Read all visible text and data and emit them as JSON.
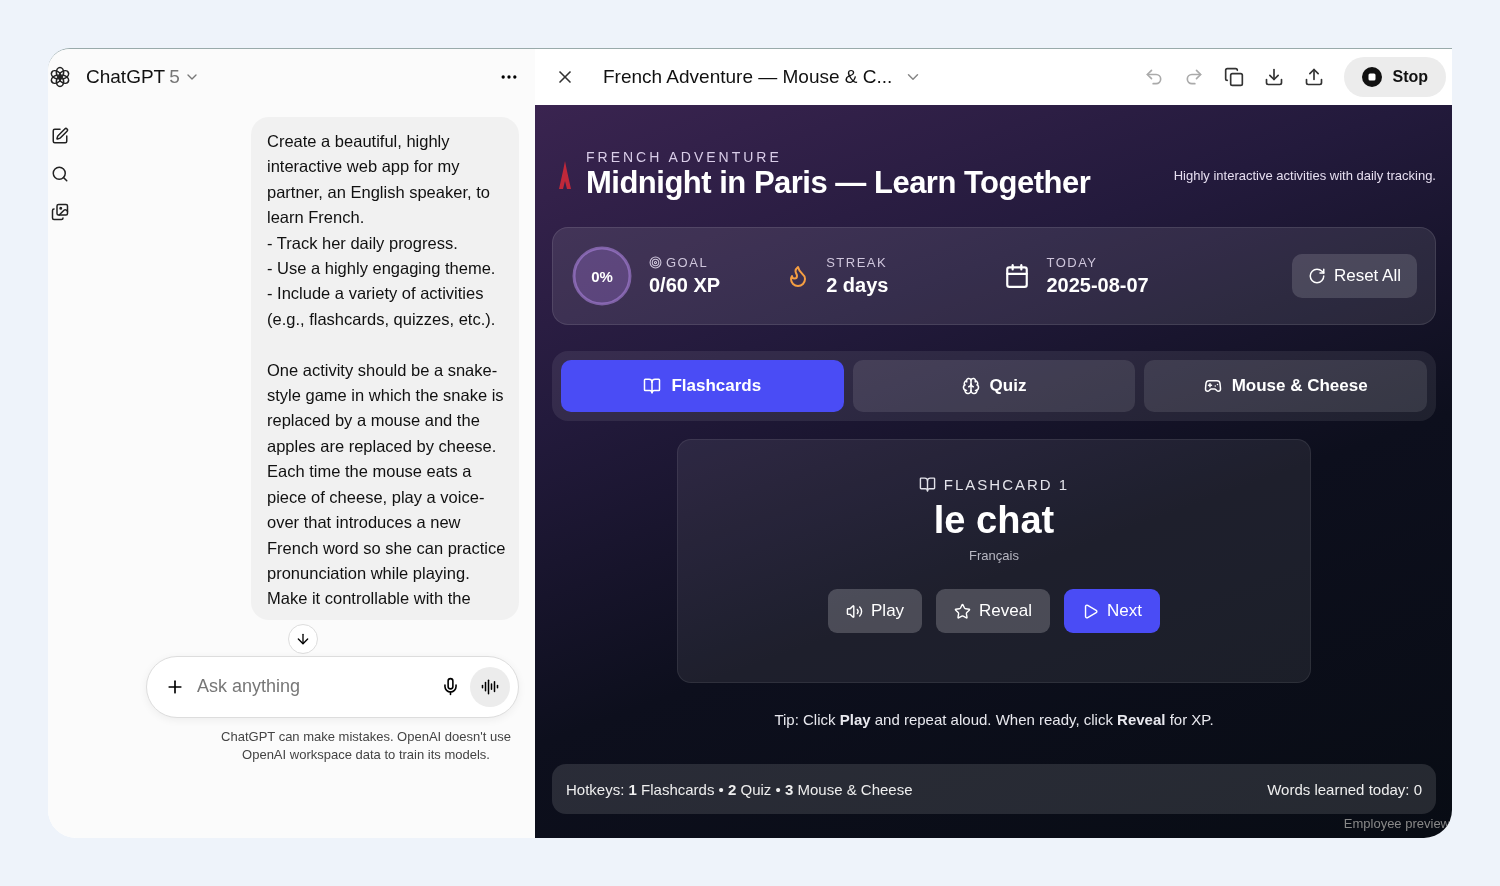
{
  "chat": {
    "model": "ChatGPT",
    "version": "5",
    "message": "Create a beautiful, highly interactive web app for my partner, an English speaker, to learn French.\n- Track her daily progress.\n- Use a highly engaging theme.\n- Include a variety of activities (e.g., flashcards, quizzes, etc.).\n\nOne activity should be a snake-style game in which the snake is replaced by a mouse and the apples are replaced by cheese. Each time the mouse eats a piece of cheese, play a voice-over that introduces a new French word so she can practice pronunciation while playing. Make it controllable with the",
    "input": {
      "placeholder": "Ask anything"
    },
    "disclaimer": "ChatGPT can make mistakes. OpenAI doesn't use OpenAI workspace data to train its models."
  },
  "canvas": {
    "title": "French Adventure — Mouse & C...",
    "stop_label": "Stop",
    "app": {
      "eyebrow": "FRENCH ADVENTURE",
      "title": "Midnight in Paris — Learn Together",
      "subtitle": "Highly interactive activities with daily tracking.",
      "stats": {
        "goal": {
          "percent": "0%",
          "level": 0,
          "label": "GOAL",
          "value": "0/60 XP"
        },
        "streak": {
          "label": "STREAK",
          "value": "2 days"
        },
        "today": {
          "label": "TODAY",
          "value": "2025-08-07"
        },
        "reset_label": "Reset All"
      },
      "tabs": [
        {
          "label": "Flashcards",
          "kind": "book",
          "selected": true
        },
        {
          "label": "Quiz",
          "kind": "brain",
          "selected": false
        },
        {
          "label": "Mouse & Cheese",
          "kind": "gamepad",
          "selected": false
        }
      ],
      "card": {
        "eyebrow": "FLASHCARD 1",
        "word": "le chat",
        "language": "Français",
        "buttons": [
          {
            "label": "Play",
            "kind": "speaker",
            "primary": false
          },
          {
            "label": "Reveal",
            "kind": "star",
            "primary": false
          },
          {
            "label": "Next",
            "kind": "play",
            "primary": true
          }
        ]
      },
      "tip": "Tip: Click **Play** and repeat aloud. When ready, click **Reveal** for XP.",
      "footer": {
        "hotkeys": "Hotkeys: **1** Flashcards • **2** Quiz • **3** Mouse & Cheese",
        "words_learned": "Words learned today: 0"
      },
      "badge": "Employee preview"
    }
  }
}
